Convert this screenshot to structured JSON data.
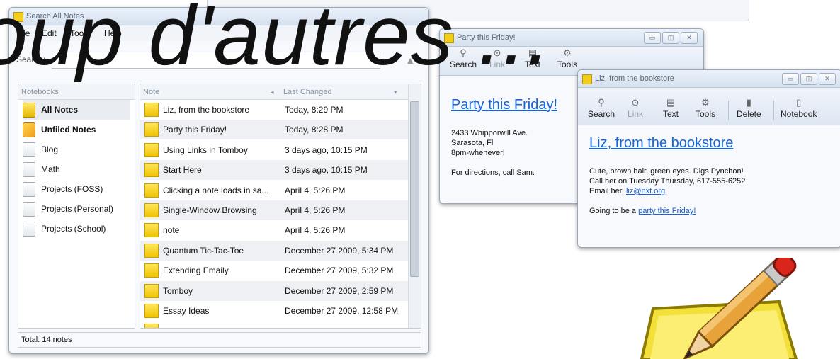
{
  "slogan": "oup d'autres ...",
  "search_window": {
    "title": "Search All Notes",
    "menu": [
      "File",
      "Edit",
      "Tools",
      "Help"
    ],
    "search_label": "Search:",
    "notebooks_header": "Notebooks",
    "notebooks": [
      {
        "label": "All Notes",
        "bold": true,
        "icon": "all-notes-icon"
      },
      {
        "label": "Unfiled Notes",
        "bold": true,
        "icon": "unfiled-notes-icon"
      },
      {
        "label": "Blog",
        "bold": false,
        "icon": "notebook-icon"
      },
      {
        "label": "Math",
        "bold": false,
        "icon": "notebook-icon"
      },
      {
        "label": "Projects (FOSS)",
        "bold": false,
        "icon": "notebook-icon"
      },
      {
        "label": "Projects (Personal)",
        "bold": false,
        "icon": "notebook-icon"
      },
      {
        "label": "Projects (School)",
        "bold": false,
        "icon": "notebook-icon"
      }
    ],
    "columns": {
      "note": "Note",
      "last_changed": "Last Changed"
    },
    "notes": [
      {
        "title": "Liz, from the bookstore",
        "changed": "Today, 8:29 PM"
      },
      {
        "title": "Party this Friday!",
        "changed": "Today, 8:28 PM"
      },
      {
        "title": "Using Links in Tomboy",
        "changed": "3 days ago, 10:15 PM"
      },
      {
        "title": "Start Here",
        "changed": "3 days ago, 10:15 PM"
      },
      {
        "title": "Clicking a note loads in sa...",
        "changed": "April 4, 5:26 PM"
      },
      {
        "title": "Single-Window Browsing",
        "changed": "April 4, 5:26 PM"
      },
      {
        "title": "note",
        "changed": "April 4, 5:26 PM"
      },
      {
        "title": "Quantum Tic-Tac-Toe",
        "changed": "December 27 2009, 5:34 PM"
      },
      {
        "title": "Extending Emaily",
        "changed": "December 27 2009, 5:32 PM"
      },
      {
        "title": "Tomboy",
        "changed": "December 27 2009, 2:59 PM"
      },
      {
        "title": "Essay Ideas",
        "changed": "December 27 2009, 12:58 PM"
      }
    ],
    "status": "Total: 14 notes"
  },
  "party_window": {
    "title": "Party this Friday!",
    "toolbar": [
      "Search",
      "Link",
      "Text",
      "Tools"
    ],
    "note_title": "Party this Friday!",
    "lines": [
      "2433 Whipporwill Ave.",
      "Sarasota, Fl",
      "8pm-whenever!",
      "",
      "For directions, call Sam."
    ]
  },
  "liz_window": {
    "title": "Liz, from the bookstore",
    "toolbar": [
      "Search",
      "Link",
      "Text",
      "Tools",
      "Delete",
      "Notebook"
    ],
    "note_title": "Liz, from the bookstore",
    "line1": "Cute, brown hair, green eyes. Digs Pynchon!",
    "line2_a": "Call her on ",
    "line2_strike": "Tuesday",
    "line2_b": " Thursday, 617-555-6252",
    "line3_a": "Email her, ",
    "line3_link": "liz@nxt.org",
    "line3_b": ".",
    "line5_a": "Going to be a ",
    "line5_link": "party this Friday!"
  },
  "colors": {
    "link": "#1565d8",
    "note_yellow": "#f0c400",
    "pencil_red": "#d9261c"
  }
}
